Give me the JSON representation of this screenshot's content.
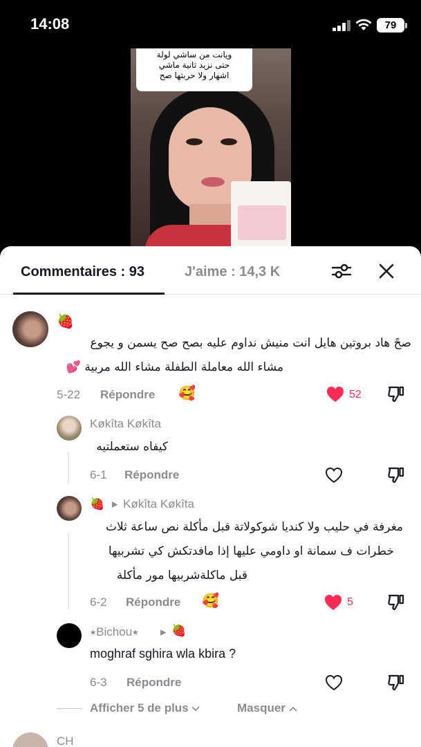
{
  "status_bar": {
    "time": "14:08",
    "battery": "79"
  },
  "video": {
    "caption_lines": [
      "ويانت من ساشي لولة",
      "حتى نزيد ثانية ماشي",
      "اشهار ولا حربتها صح"
    ]
  },
  "tabs": {
    "comments": "Commentaires : 93",
    "likes": "J'aime : 14,3 K"
  },
  "comments": [
    {
      "name": "🍓",
      "line1": "صحً هاد بروتين هايل انت منيش نداوم عليه بصح صح يسمن و يجوع",
      "line2": "مشاء الله معاملة الطفلة مشاء الله مربية 💕",
      "date": "5-22",
      "reply": "Répondre",
      "likes": "52"
    }
  ],
  "replies": [
    {
      "name": "Køkîta Køkîta",
      "text": "كيفاه ستعملتيه",
      "date": "6-1",
      "reply": "Répondre"
    },
    {
      "name": "🍓",
      "to": "Køkîta Køkîta",
      "line1": "مغرفة في حليب ولا كنديا شوكولاتة قبل مأكلة نص ساعة ثلاث",
      "line2": "خطرات ف سمانة او داومي عليها إذا مافدتكش كي تشربيها",
      "line3": "قبل ماكلةشربيها مور مأكلة",
      "date": "6-2",
      "reply": "Répondre",
      "likes": "5"
    },
    {
      "name": "⭑Bichou⭑",
      "to": "🍓",
      "text": "moghraf sghira wla kbira ?",
      "date": "6-3",
      "reply": "Répondre"
    }
  ],
  "thread_controls": {
    "show_more": "Afficher 5 de plus",
    "hide": "Masquer"
  },
  "next_comment": {
    "name": "CH"
  },
  "colors": {
    "like_red": "#fe2c55",
    "text": "#161823",
    "muted": "#8a8b91"
  }
}
